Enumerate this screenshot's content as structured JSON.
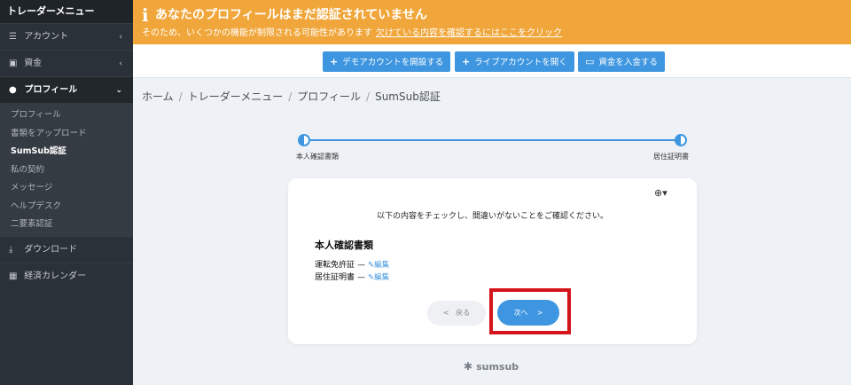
{
  "sidebar": {
    "title": "トレーダーメニュー",
    "items": [
      {
        "label": "アカウント",
        "icon": "list-icon",
        "chevron": "‹"
      },
      {
        "label": "資金",
        "icon": "wallet-icon",
        "chevron": "‹"
      },
      {
        "label": "プロフィール",
        "icon": "user-icon",
        "chevron": "⌄"
      },
      {
        "label": "ダウンロード",
        "icon": "download-icon"
      },
      {
        "label": "経済カレンダー",
        "icon": "calendar-icon"
      }
    ],
    "profile_sub": [
      "プロフィール",
      "書類をアップロード",
      "SumSub認証",
      "私の契約",
      "メッセージ",
      "ヘルプデスク",
      "二要素認証"
    ]
  },
  "banner": {
    "title": "あなたのプロフィールはまだ認証されていません",
    "text": "そのため、いくつかの機能が制限される可能性があります",
    "link": "欠けている内容を確認するにはここをクリック",
    "color": "#f0a63a"
  },
  "actions": {
    "demo": "デモアカウントを開設する",
    "live": "ライブアカウントを開く",
    "deposit": "資金を入金する"
  },
  "breadcrumb": [
    "ホーム",
    "トレーダーメニュー",
    "プロフィール",
    "SumSub認証"
  ],
  "progress": {
    "step1": "本人確認書類",
    "step2": "居住証明書"
  },
  "card": {
    "instruction": "以下の内容をチェックし、間違いがないことをご確認ください。",
    "heading": "本人確認書類",
    "docs": [
      {
        "name": "運転免許証",
        "edit": "編集"
      },
      {
        "name": "居住証明書",
        "edit": "編集"
      }
    ],
    "back": "戻る",
    "next": "次へ"
  },
  "footer": {
    "brand": "sumsub"
  },
  "accent": "#3e96e0"
}
